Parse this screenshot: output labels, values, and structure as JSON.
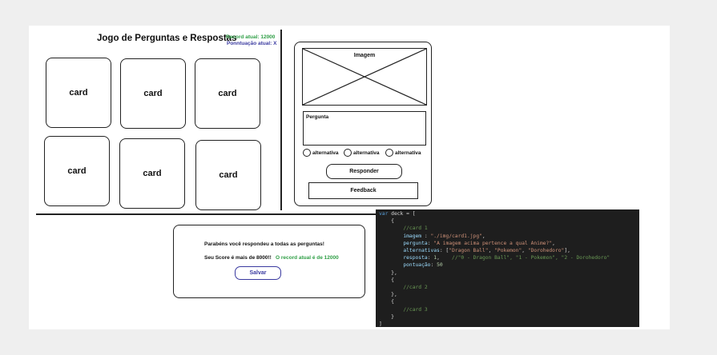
{
  "header": {
    "title": "Jogo de Perguntas e Respostas",
    "record": "Record atual: 12000",
    "score": "Ponntuação atual: X"
  },
  "cards": [
    "card",
    "card",
    "card",
    "card",
    "card",
    "card"
  ],
  "question_panel": {
    "image_label": "Imagem",
    "question_label": "Pergunta",
    "alternatives": [
      "alternativa",
      "alternativa",
      "alternativa"
    ],
    "answer_button": "Responder",
    "feedback": "Feedback"
  },
  "result_box": {
    "message": "Parabéns você respondeu a todas as perguntas!",
    "score_line": "Seu Score é mais de 8000!!",
    "record_line": "O record atual é de 12000",
    "save_button": "Salvar"
  },
  "code": {
    "lines": [
      "var deck = [",
      "    {",
      "        //card 1",
      "        imagem : \"./img/card1.jpg\",",
      "        pergunta: \"A imagem acima pertence a qual Anime?\",",
      "        alternativas: [\"Dragon Ball\", \"Pokemon\", \"Dorohedoro\"],",
      "        resposta: 1,    //\"0 - Dragon Ball\", \"1 - Pokemon\", \"2 - Dorohedoro\"",
      "        pontuação: 50",
      "    },",
      "    {",
      "        //card 2",
      "    },",
      "    {",
      "        //card 3",
      "    }",
      "]"
    ]
  },
  "colors": {
    "record_green": "#2e9e45",
    "score_blue": "#3a3aa0",
    "editor_bg": "#1e1e1e"
  }
}
